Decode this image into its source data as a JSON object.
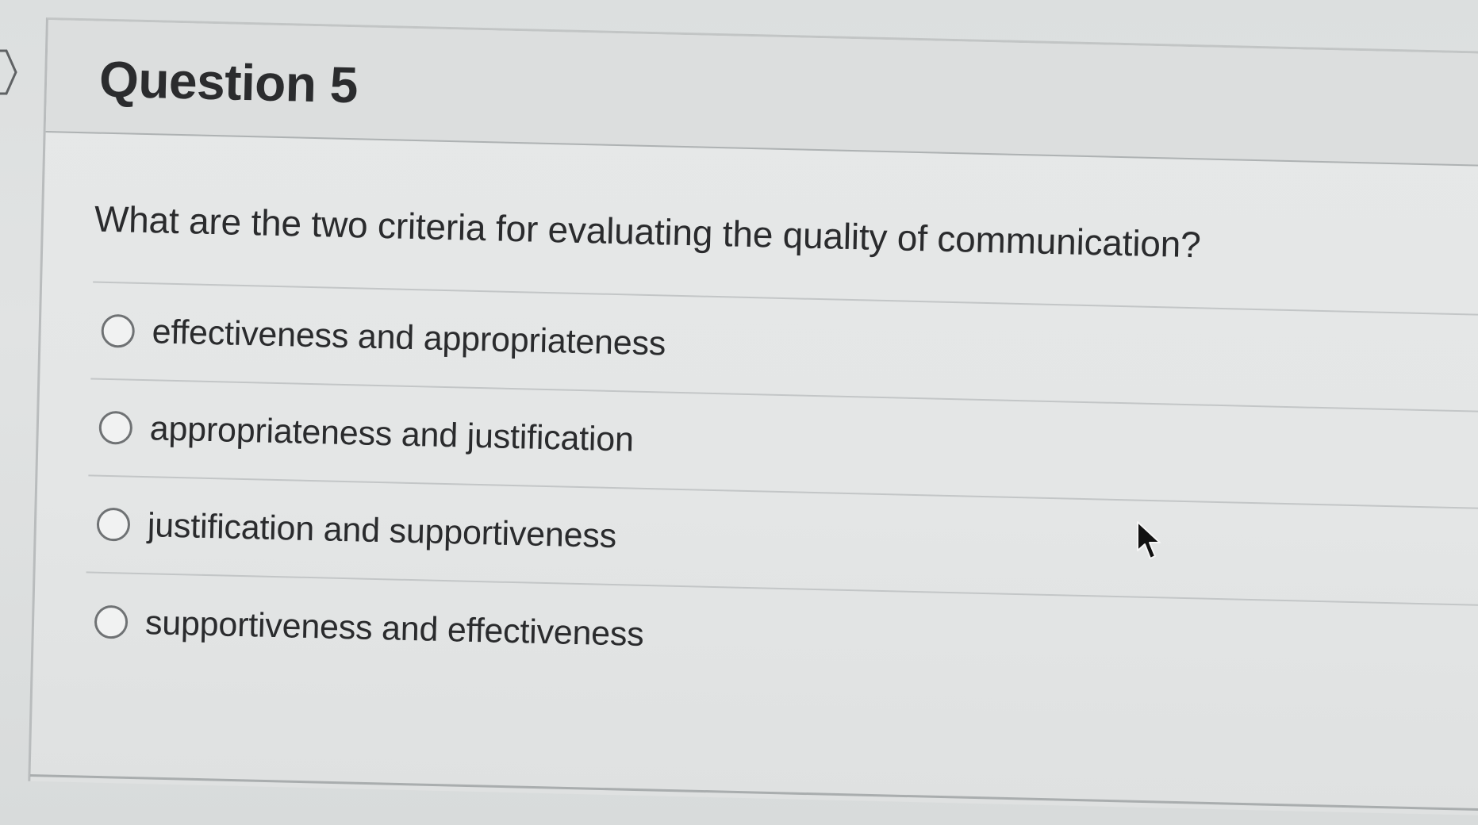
{
  "question": {
    "title": "Question 5",
    "prompt": "What are the two criteria for evaluating the quality of communication?",
    "options": [
      {
        "label": "effectiveness and appropriateness",
        "selected": false
      },
      {
        "label": "appropriateness and justification",
        "selected": false
      },
      {
        "label": "justification and supportiveness",
        "selected": false
      },
      {
        "label": "supportiveness and effectiveness",
        "selected": false
      }
    ]
  },
  "icons": {
    "bookmark": "bookmark-flag-icon",
    "cursor": "mouse-pointer-icon",
    "radio": "radio-button-unselected"
  },
  "colors": {
    "text": "#2a2b2d",
    "divider": "#c3c6c7",
    "header_bg": "#dcdede",
    "radio_border": "#6f7274"
  }
}
